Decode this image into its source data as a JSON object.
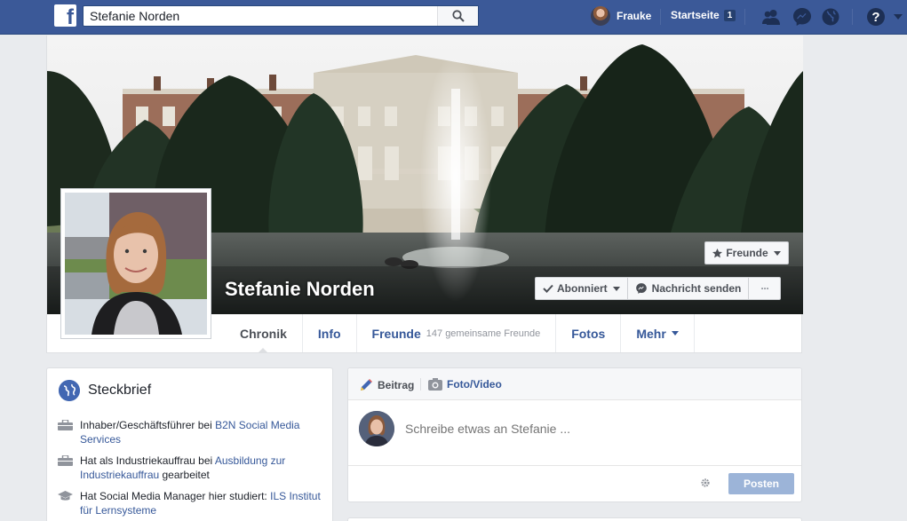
{
  "topbar": {
    "search_value": "Stefanie Norden",
    "user_name": "Frauke",
    "home_label": "Startseite",
    "home_count": "1"
  },
  "profile": {
    "name": "Stefanie Norden",
    "friends_button": "Freunde",
    "subscribed_button": "Abonniert",
    "message_button": "Nachricht senden",
    "more_button": "···"
  },
  "tabs": {
    "chronik": "Chronik",
    "info": "Info",
    "freunde": "Freunde",
    "freunde_sub": "147 gemeinsame Freunde",
    "fotos": "Fotos",
    "mehr": "Mehr"
  },
  "intro": {
    "title": "Steckbrief",
    "items": [
      {
        "prefix": "Inhaber/Geschäftsführer bei ",
        "link": "B2N Social Media Services",
        "suffix": ""
      },
      {
        "prefix": "Hat als Industriekauffrau bei ",
        "link": "Ausbildung zur Industriekauffrau",
        "suffix": " gearbeitet"
      },
      {
        "prefix": "Hat Social Media Manager hier studiert: ",
        "link": "ILS Institut für Lernsysteme",
        "suffix": ""
      }
    ]
  },
  "composer": {
    "tab_post": "Beitrag",
    "tab_photo": "Foto/Video",
    "placeholder": "Schreibe etwas an Stefanie ...",
    "post_button": "Posten"
  },
  "colors": {
    "brand": "#3b5998",
    "link": "#365899",
    "background": "#e9ebee"
  }
}
